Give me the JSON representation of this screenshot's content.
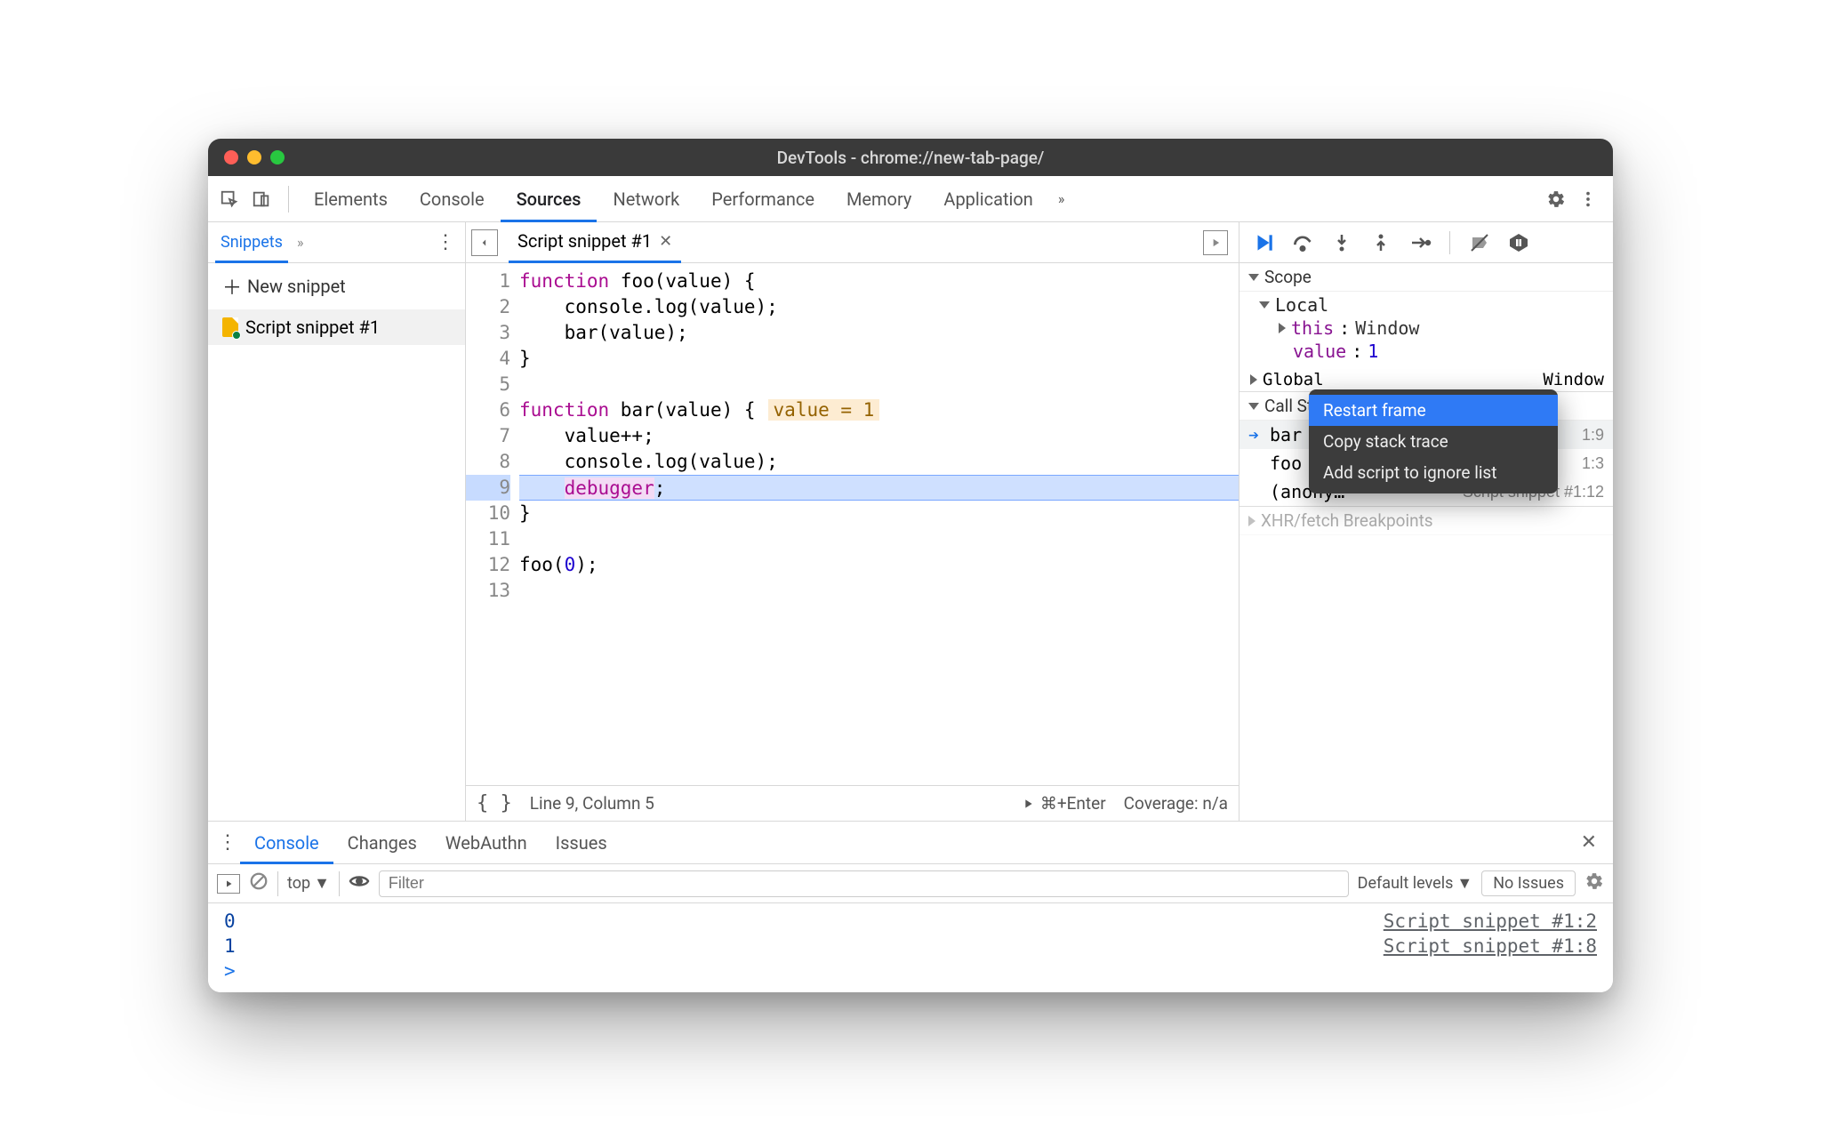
{
  "window": {
    "title": "DevTools - chrome://new-tab-page/"
  },
  "topTabs": {
    "items": [
      "Elements",
      "Console",
      "Sources",
      "Network",
      "Performance",
      "Memory",
      "Application"
    ],
    "more": "»"
  },
  "sidebar": {
    "activeTab": "Snippets",
    "more": "»",
    "newSnippet": "New snippet",
    "items": [
      {
        "label": "Script snippet #1"
      }
    ]
  },
  "editor": {
    "tab": "Script snippet #1",
    "lines": [
      "1",
      "2",
      "3",
      "4",
      "5",
      "6",
      "7",
      "8",
      "9",
      "10",
      "11",
      "12",
      "13"
    ],
    "inlineHint": "value = 1",
    "footer": {
      "pos": "Line 9, Column 5",
      "run": "⌘+Enter",
      "coverage": "Coverage: n/a"
    }
  },
  "codeTokens": {
    "l1": {
      "kw": "function",
      "rest": " foo(value) {"
    },
    "l2": "    console.log(value);",
    "l3": "    bar(value);",
    "l4": "}",
    "l5": "",
    "l6": {
      "kw": "function",
      "rest": " bar(value) {"
    },
    "l7": "    value++;",
    "l8": "    console.log(value);",
    "l9": {
      "indent": "    ",
      "kw": "debugger",
      "semi": ";"
    },
    "l10": "}",
    "l11": "",
    "l12pre": "foo(",
    "l12num": "0",
    "l12post": ");",
    "l13": ""
  },
  "debugger": {
    "scope": {
      "header": "Scope",
      "localHeader": "Local",
      "thisLabel": "this",
      "thisVal": "Window",
      "valueLabel": "value",
      "valueVal": "1",
      "globalHeader": "Global",
      "globalVal": "Window"
    },
    "callStack": {
      "header": "Call Stack",
      "frames": [
        {
          "name": "bar",
          "src": "1:9",
          "active": true
        },
        {
          "name": "foo",
          "src": "1:3",
          "active": false
        },
        {
          "name": "(anonymous)",
          "src": "Script snippet #1:12",
          "active": false
        }
      ]
    },
    "xhrHeader": "XHR/fetch Breakpoints",
    "contextMenu": {
      "items": [
        "Restart frame",
        "Copy stack trace",
        "Add script to ignore list"
      ]
    }
  },
  "drawer": {
    "tabs": [
      "Console",
      "Changes",
      "WebAuthn",
      "Issues"
    ],
    "toolbar": {
      "context": "top",
      "filterPlaceholder": "Filter",
      "levels": "Default levels",
      "issues": "No Issues"
    },
    "lines": [
      {
        "val": "0",
        "src": "Script snippet #1:2"
      },
      {
        "val": "1",
        "src": "Script snippet #1:8"
      }
    ],
    "prompt": ">"
  }
}
